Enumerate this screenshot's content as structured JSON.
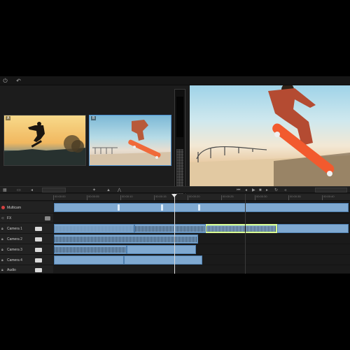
{
  "toolbar": {
    "power_icon": "power-icon",
    "undo_icon": "undo-icon",
    "faint_text": ""
  },
  "multicam": {
    "angles": [
      {
        "label": "A"
      },
      {
        "label": "B"
      }
    ],
    "selected_angle_color": "#4b8fd0"
  },
  "transport": {
    "zoom_field": "",
    "timecode": ""
  },
  "timeline": {
    "ruler_labels": [
      "00:00:00",
      "00:00:05",
      "00:00:10",
      "00:00:15",
      "00:00:20",
      "00:00:25",
      "00:00:30",
      "00:00:35",
      "00:00:40"
    ],
    "tracks": [
      {
        "name": "Multicam",
        "color": "#d64040"
      },
      {
        "name": "FX",
        "color": ""
      },
      {
        "name": "Camera 1",
        "color": ""
      },
      {
        "name": "Camera 2",
        "color": ""
      },
      {
        "name": "Camera 3",
        "color": ""
      },
      {
        "name": "Camera 4",
        "color": ""
      },
      {
        "name": "Audio",
        "color": ""
      }
    ],
    "clip_color": "#7fa9d1",
    "highlight_color": "#c8ff6a"
  }
}
